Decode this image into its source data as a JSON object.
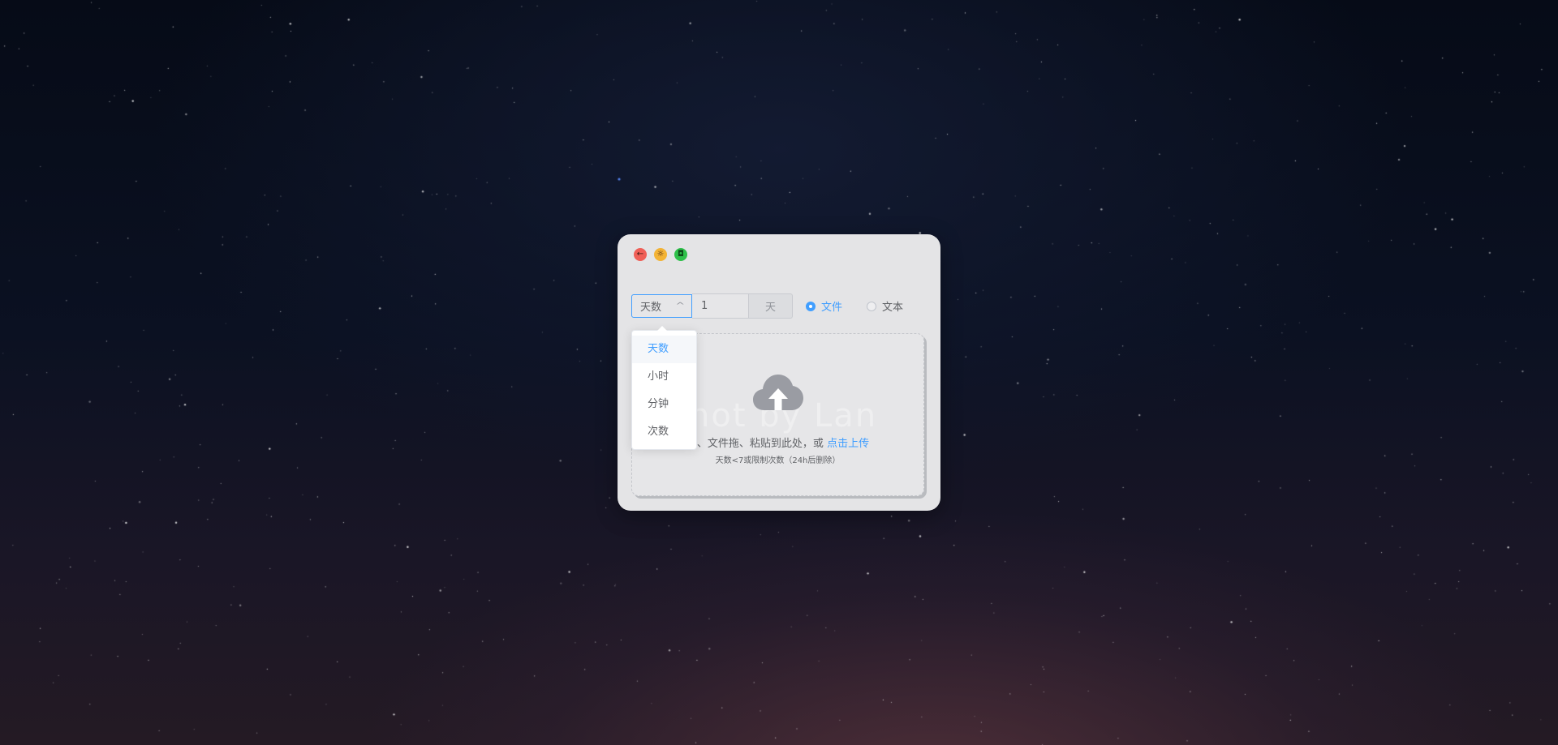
{
  "window": {
    "traffic_lights": [
      {
        "name": "back-icon",
        "glyph": "←",
        "color": "#ef5f57"
      },
      {
        "name": "theme-icon",
        "glyph": "☼",
        "color": "#f3b335"
      },
      {
        "name": "save-icon",
        "glyph": "◘",
        "color": "#2ec04a"
      }
    ]
  },
  "expire": {
    "type_selected": "天数",
    "options": [
      "天数",
      "小时",
      "分钟",
      "次数"
    ],
    "value": "1",
    "unit": "天"
  },
  "upload_type": {
    "options": [
      {
        "label": "文件",
        "checked": true
      },
      {
        "label": "文本",
        "checked": false
      }
    ]
  },
  "dropzone": {
    "text": "字、文件拖、粘贴到此处，或 ",
    "link": "点击上传",
    "tip": "天数<7或限制次数（24h后删除）",
    "watermark": "hot by Lan"
  },
  "colors": {
    "accent": "#409eff",
    "window_bg": "#e4e4e6"
  }
}
